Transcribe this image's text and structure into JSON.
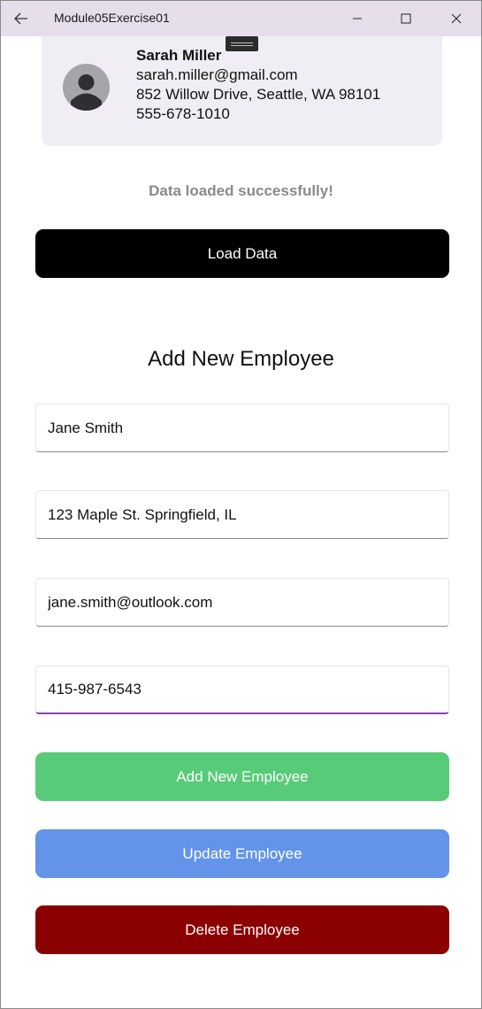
{
  "window": {
    "title": "Module05Exercise01",
    "back_icon": "arrow-left-icon",
    "minimize_icon": "minimize-icon",
    "maximize_icon": "maximize-icon",
    "close_icon": "close-icon"
  },
  "employee_card": {
    "name": "Sarah Miller",
    "email": "sarah.miller@gmail.com",
    "address": "852 Willow Drive, Seattle, WA 98101",
    "phone": "555-678-1010",
    "avatar_icon": "person-avatar-icon"
  },
  "status_message": "Data loaded successfully!",
  "load_button_label": "Load Data",
  "form": {
    "title": "Add New Employee",
    "name_value": "Jane Smith",
    "address_value": "123 Maple St. Springfield, IL",
    "email_value": "jane.smith@outlook.com",
    "phone_value": "415-987-6543"
  },
  "buttons": {
    "add_label": "Add New Employee",
    "update_label": "Update Employee",
    "delete_label": "Delete Employee"
  },
  "colors": {
    "titlebar": "#e6deea",
    "card_bg": "#f0eef4",
    "load_button": "#000000",
    "add_button": "#57cb78",
    "update_button": "#6394ea",
    "delete_button": "#8b0000",
    "focus_underline": "#8b3fb5",
    "status_text": "#8a8a8a"
  }
}
